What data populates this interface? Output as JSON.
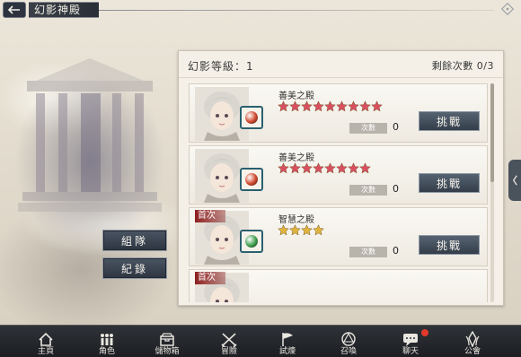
{
  "header": {
    "title": "幻影神殿"
  },
  "left_buttons": {
    "team": "組隊",
    "record": "紀錄"
  },
  "panel": {
    "level_text": "幻影等級：1",
    "remaining_text": "剩餘次數 0/3",
    "count_label": "次數",
    "challenge_label": "挑戰",
    "first_tag": "首次",
    "rows": [
      {
        "name": "善美之殿",
        "stars": 9,
        "star_color": "#d85060",
        "gem_color": "#d0452a",
        "count": "0",
        "first": false
      },
      {
        "name": "善美之殿",
        "stars": 8,
        "star_color": "#d85060",
        "gem_color": "#d0452a",
        "count": "0",
        "first": false
      },
      {
        "name": "智慧之殿",
        "stars": 4,
        "star_color": "#e0b43c",
        "gem_color": "#3b9d4a",
        "count": "0",
        "first": true
      },
      {
        "name": "",
        "stars": 0,
        "star_color": "#e0b43c",
        "gem_color": "#3b9d4a",
        "count": "",
        "first": true
      }
    ]
  },
  "bottom_nav": [
    {
      "label": "主頁",
      "icon": "home-icon"
    },
    {
      "label": "角色",
      "icon": "characters-icon"
    },
    {
      "label": "儲物箱",
      "icon": "storage-box-icon"
    },
    {
      "label": "冒險",
      "icon": "crossed-swords-icon"
    },
    {
      "label": "試煉",
      "icon": "flag-icon"
    },
    {
      "label": "召喚",
      "icon": "summon-circle-icon"
    },
    {
      "label": "聊天",
      "icon": "chat-bubble-icon",
      "badge": true
    },
    {
      "label": "公會",
      "icon": "guild-emblem-icon"
    }
  ]
}
